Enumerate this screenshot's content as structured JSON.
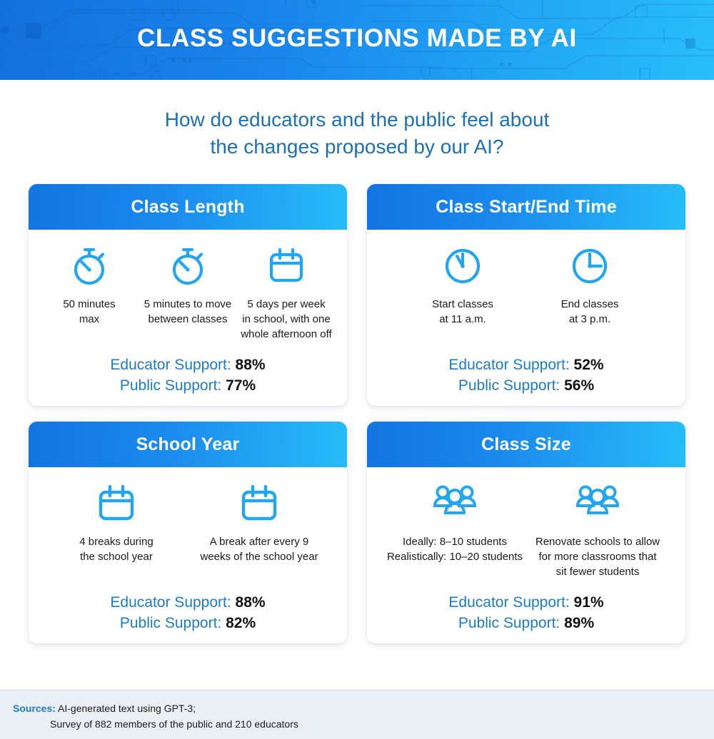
{
  "header": {
    "title": "CLASS SUGGESTIONS MADE BY AI",
    "bg_gradient_from": "#1370DC",
    "bg_gradient_to": "#28BEFA"
  },
  "subtitle": {
    "line1": "How do educators and the public feel about",
    "line2": "the changes proposed by our AI?",
    "color": "#1C70B6"
  },
  "labels": {
    "educator_support": "Educator Support:",
    "public_support": "Public Support:"
  },
  "cards": [
    {
      "title": "Class Length",
      "items": [
        {
          "icon": "stopwatch-icon",
          "lines": [
            "50 minutes",
            "max"
          ]
        },
        {
          "icon": "stopwatch-icon",
          "lines": [
            "5 minutes to move",
            "between classes"
          ]
        },
        {
          "icon": "calendar-icon",
          "lines": [
            "5 days per week",
            "in school, with one",
            "whole afternoon off"
          ]
        }
      ],
      "educator_support": "88%",
      "public_support": "77%"
    },
    {
      "title": "Class Start/End Time",
      "items": [
        {
          "icon": "clock-11-icon",
          "lines": [
            "Start classes",
            "at 11 a.m."
          ]
        },
        {
          "icon": "clock-3-icon",
          "lines": [
            "End classes",
            "at 3 p.m."
          ]
        }
      ],
      "educator_support": "52%",
      "public_support": "56%"
    },
    {
      "title": "School Year",
      "items": [
        {
          "icon": "calendar-icon",
          "lines": [
            "4 breaks during",
            "the school year"
          ]
        },
        {
          "icon": "calendar-icon",
          "lines": [
            "A break after every 9",
            "weeks of the school year"
          ]
        }
      ],
      "educator_support": "88%",
      "public_support": "82%"
    },
    {
      "title": "Class Size",
      "items": [
        {
          "icon": "people-group-icon",
          "lines": [
            "Ideally: 8–10 students",
            "Realistically:  10–20 students"
          ]
        },
        {
          "icon": "people-group-icon",
          "lines": [
            "Renovate schools to allow",
            "for more classrooms that",
            "sit fewer students"
          ]
        }
      ],
      "educator_support": "91%",
      "public_support": "89%"
    }
  ],
  "footer": {
    "label": "Sources:",
    "line1": "AI-generated text using GPT-3;",
    "line2": "Survey of 882 members of the public and 210 educators"
  }
}
